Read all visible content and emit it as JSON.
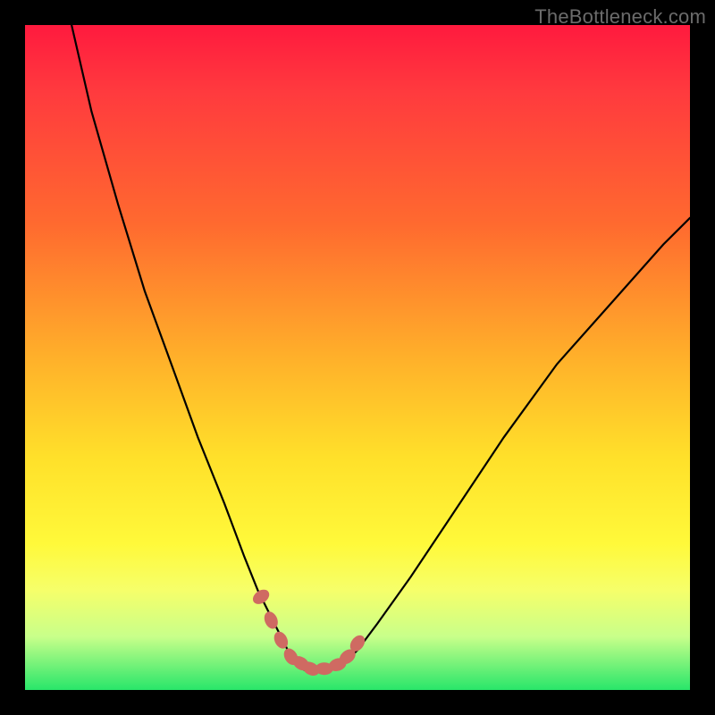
{
  "watermark": "TheBottleneck.com",
  "colors": {
    "frame": "#000000",
    "gradient_top": "#ff1a3e",
    "gradient_bottom": "#28e66a",
    "curve": "#000000",
    "marker": "#cf6a62"
  },
  "chart_data": {
    "type": "line",
    "title": "",
    "xlabel": "",
    "ylabel": "",
    "xlim": [
      0,
      100
    ],
    "ylim": [
      0,
      100
    ],
    "grid": false,
    "legend": false,
    "series": [
      {
        "name": "curve",
        "x": [
          7,
          10,
          14,
          18,
          22,
          26,
          30,
          33,
          35,
          37,
          39,
          40,
          41,
          42,
          44,
          46,
          48,
          50,
          53,
          58,
          64,
          72,
          80,
          88,
          96,
          100
        ],
        "y": [
          100,
          87,
          73,
          60,
          49,
          38,
          28,
          20,
          15,
          11,
          7,
          5,
          4,
          3,
          3,
          3,
          4,
          6,
          10,
          17,
          26,
          38,
          49,
          58,
          67,
          71
        ]
      }
    ],
    "markers": {
      "name": "highlight-points",
      "x": [
        35.5,
        37,
        38.5,
        40,
        41.5,
        43,
        45,
        47,
        48.5,
        50
      ],
      "y": [
        14,
        10.5,
        7.5,
        5,
        4,
        3.2,
        3.2,
        3.8,
        5,
        7
      ]
    }
  }
}
